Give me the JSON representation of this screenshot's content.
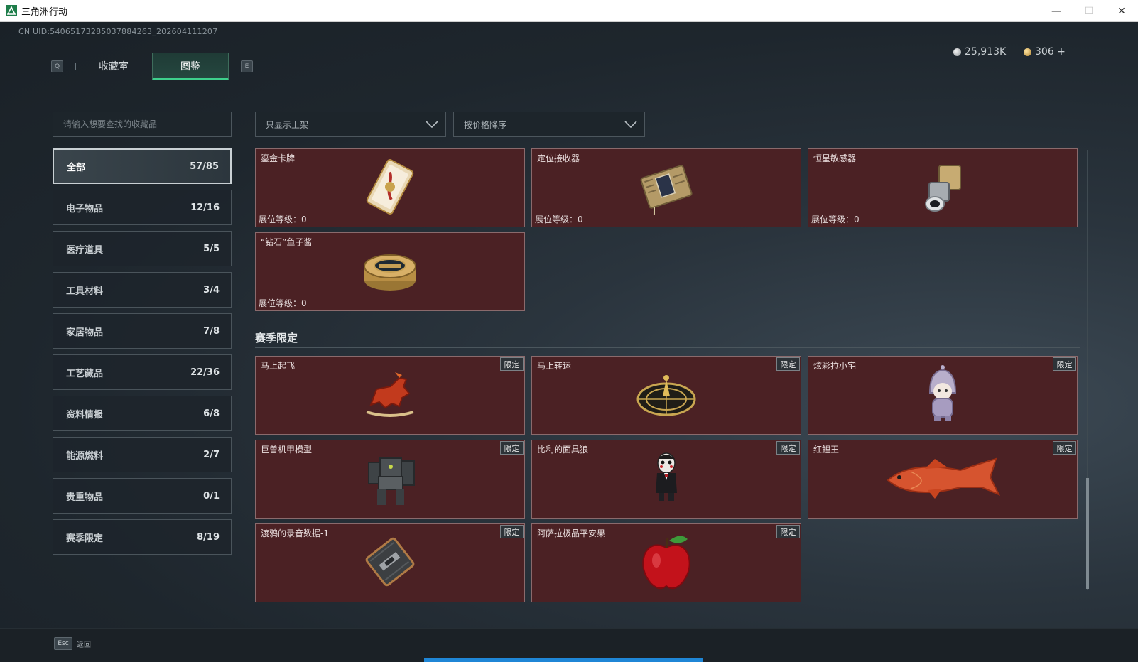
{
  "window": {
    "title": "三角洲行动",
    "controls": {
      "minimize": "—",
      "maximize": "☐",
      "close": "✕"
    }
  },
  "header": {
    "uid": "CN UID:5406517328503788426​3_2026041112​07",
    "key_left": "Q",
    "key_right": "E",
    "tabs": [
      {
        "label": "收藏室",
        "active": false
      },
      {
        "label": "图鉴",
        "active": true
      }
    ],
    "currency": [
      {
        "icon": "silver-coin-icon",
        "value": "25,913K"
      },
      {
        "icon": "gold-coin-icon",
        "value": "306 +"
      }
    ]
  },
  "search": {
    "placeholder": "请输入想要查找的收藏品"
  },
  "categories": [
    {
      "label": "全部",
      "count": "57/85",
      "active": true
    },
    {
      "label": "电子物品",
      "count": "12/16"
    },
    {
      "label": "医疗道具",
      "count": "5/5"
    },
    {
      "label": "工具材料",
      "count": "3/4"
    },
    {
      "label": "家居物品",
      "count": "7/8"
    },
    {
      "label": "工艺藏品",
      "count": "22/36"
    },
    {
      "label": "资料情报",
      "count": "6/8"
    },
    {
      "label": "能源燃料",
      "count": "2/7"
    },
    {
      "label": "贵重物品",
      "count": "0/1"
    },
    {
      "label": "赛季限定",
      "count": "8/19"
    }
  ],
  "filters": {
    "availability": "只显示上架",
    "sort": "按价格降序"
  },
  "items": [
    {
      "name": "鎏金卡牌",
      "level": "展位等级：0",
      "icon": "gold-card-icon"
    },
    {
      "name": "定位接收器",
      "level": "展位等级：0",
      "icon": "receiver-icon"
    },
    {
      "name": "恒星敏感器",
      "level": "展位等级：0",
      "icon": "star-sensor-icon"
    },
    {
      "name": "“钻石”鱼子酱",
      "level": "展位等级：0",
      "icon": "caviar-tin-icon"
    }
  ],
  "season": {
    "title": "赛季限定",
    "badge": "限定",
    "items": [
      {
        "name": "马上起飞",
        "icon": "rocking-horse-icon"
      },
      {
        "name": "马上转运",
        "icon": "fortune-wheel-icon"
      },
      {
        "name": "炫彩拉小宅",
        "icon": "hooded-doll-icon"
      },
      {
        "name": "巨兽机甲模型",
        "icon": "mech-model-icon"
      },
      {
        "name": "比利的面具狼",
        "icon": "puppet-doll-icon"
      },
      {
        "name": "红鲤王",
        "icon": "red-carp-icon"
      },
      {
        "name": "渡鸦的录音数据-1",
        "icon": "data-drive-icon"
      },
      {
        "name": "阿萨拉极品平安果",
        "icon": "red-apple-icon"
      }
    ]
  },
  "footer": {
    "esc_key": "Esc",
    "esc_label": "返回"
  },
  "colors": {
    "card": "#4b2124",
    "accent": "#3ed08c",
    "bottom_bar": "#1f86d6"
  }
}
